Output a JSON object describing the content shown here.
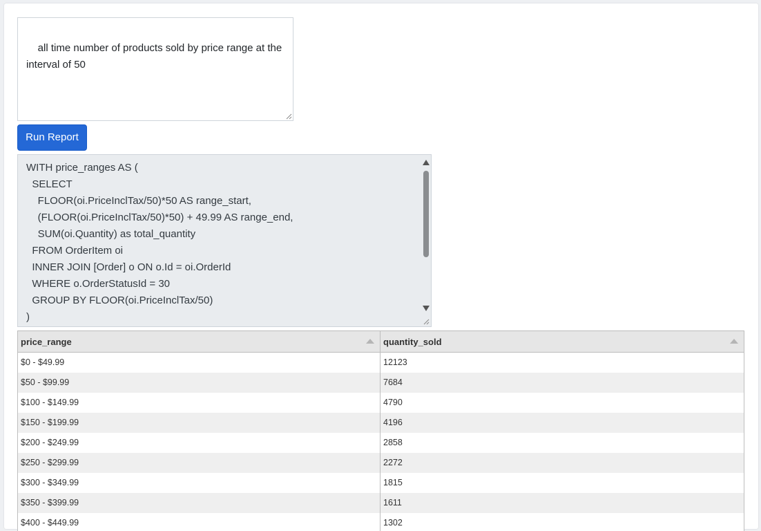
{
  "prompt": {
    "text": "all time number of products sold by price range at the interval of 50"
  },
  "run_button": {
    "label": "Run Report"
  },
  "sql": {
    "text": "WITH price_ranges AS (\n  SELECT\n    FLOOR(oi.PriceInclTax/50)*50 AS range_start,\n    (FLOOR(oi.PriceInclTax/50)*50) + 49.99 AS range_end,\n    SUM(oi.Quantity) as total_quantity\n  FROM OrderItem oi\n  INNER JOIN [Order] o ON o.Id = oi.OrderId\n  WHERE o.OrderStatusId = 30\n  GROUP BY FLOOR(oi.PriceInclTax/50)\n)"
  },
  "table": {
    "columns": [
      "price_range",
      "quantity_sold"
    ],
    "rows": [
      [
        "$0 - $49.99",
        "12123"
      ],
      [
        "$50 - $99.99",
        "7684"
      ],
      [
        "$100 - $149.99",
        "4790"
      ],
      [
        "$150 - $199.99",
        "4196"
      ],
      [
        "$200 - $249.99",
        "2858"
      ],
      [
        "$250 - $299.99",
        "2272"
      ],
      [
        "$300 - $349.99",
        "1815"
      ],
      [
        "$350 - $399.99",
        "1611"
      ],
      [
        "$400 - $449.99",
        "1302"
      ]
    ]
  },
  "colors": {
    "accent": "#2468d6",
    "header_bg": "#e6e6e6",
    "stripe": "#efefef"
  }
}
